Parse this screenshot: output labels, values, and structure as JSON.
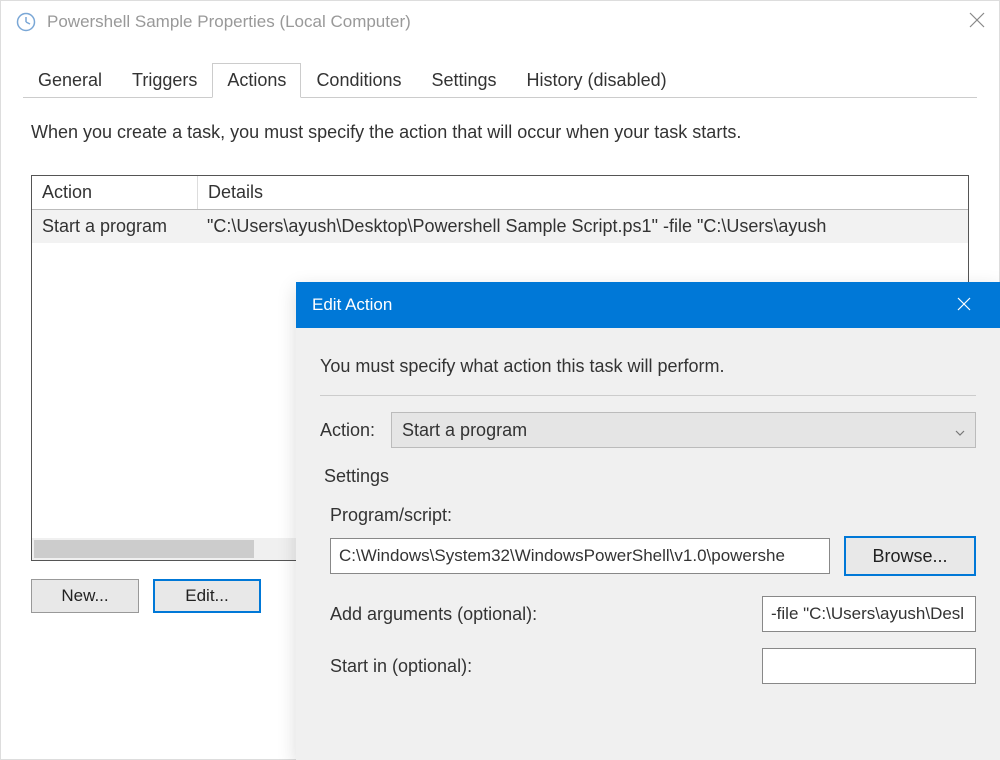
{
  "parent_window": {
    "title": "Powershell Sample Properties (Local Computer)",
    "tabs": [
      {
        "label": "General"
      },
      {
        "label": "Triggers"
      },
      {
        "label": "Actions"
      },
      {
        "label": "Conditions"
      },
      {
        "label": "Settings"
      },
      {
        "label": "History (disabled)"
      }
    ],
    "intro": "When you create a task, you must specify the action that will occur when your task starts.",
    "table": {
      "col_action": "Action",
      "col_details": "Details",
      "rows": [
        {
          "action": "Start a program",
          "details": "\"C:\\Users\\ayush\\Desktop\\Powershell Sample Script.ps1\" -file \"C:\\Users\\ayush"
        }
      ]
    },
    "buttons": {
      "new": "New...",
      "edit": "Edit..."
    }
  },
  "edit_action": {
    "title": "Edit Action",
    "prompt": "You must specify what action this task will perform.",
    "action_label": "Action:",
    "action_value": "Start a program",
    "settings_label": "Settings",
    "program_label": "Program/script:",
    "program_value": "C:\\Windows\\System32\\WindowsPowerShell\\v1.0\\powershe",
    "browse_label": "Browse...",
    "arguments_label": "Add arguments (optional):",
    "arguments_value": "-file \"C:\\Users\\ayush\\Desl",
    "startin_label": "Start in (optional):",
    "startin_value": ""
  }
}
